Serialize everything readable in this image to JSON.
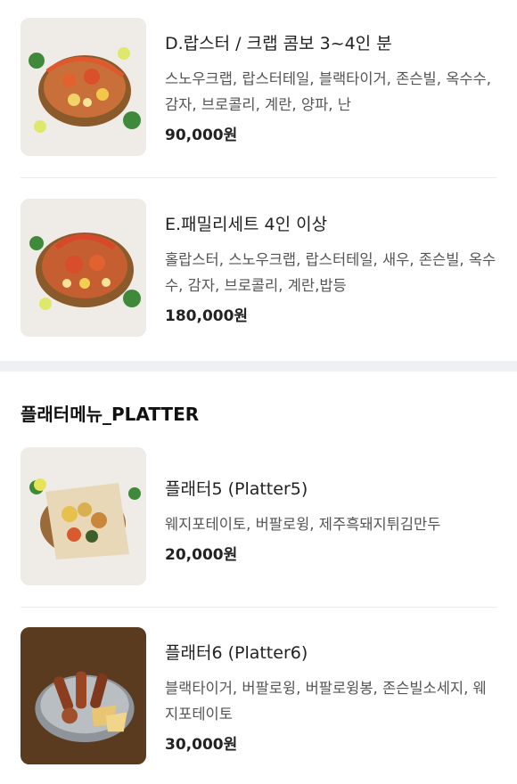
{
  "items_top": [
    {
      "name": "D.랍스터 / 크랩 콤보 3~4인 분",
      "desc": "스노우크랩, 랍스터테일, 블랙타이거, 존슨빌, 옥수수, 감자, 브로콜리, 계란, 양파, 난",
      "price": "90,000원",
      "image": "lobster-crab-combo-photo"
    },
    {
      "name": "E.패밀리세트 4인 이상",
      "desc": "홀랍스터, 스노우크랩, 랍스터테일, 새우, 존슨빌, 옥수수, 감자, 브로콜리, 계란,밥등",
      "price": "180,000원",
      "image": "family-set-photo"
    }
  ],
  "section": {
    "title": "플래터메뉴_PLATTER"
  },
  "items_platter": [
    {
      "name": "플래터5 (Platter5)",
      "desc": "웨지포테이토, 버팔로윙, 제주흑돼지튀김만두",
      "price": "20,000원",
      "image": "platter5-photo"
    },
    {
      "name": "플래터6 (Platter6)",
      "desc": "블랙타이거, 버팔로윙, 버팔로윙봉, 존슨빌소세지, 웨지포테이토",
      "price": "30,000원",
      "image": "platter6-photo"
    }
  ],
  "colors": {
    "section_band": "#eef0f3",
    "divider": "#ececec"
  }
}
